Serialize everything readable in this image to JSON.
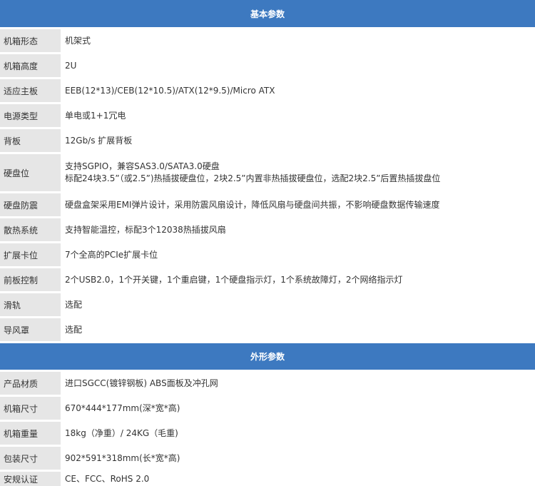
{
  "sections": [
    {
      "title": "基本参数",
      "rows": [
        {
          "label": "机箱形态",
          "lines": [
            "机架式"
          ]
        },
        {
          "label": "机箱高度",
          "lines": [
            "2U"
          ]
        },
        {
          "label": "适应主板",
          "lines": [
            "EEB(12*13)/CEB(12*10.5)/ATX(12*9.5)/Micro ATX"
          ]
        },
        {
          "label": "电源类型",
          "lines": [
            "单电或1+1冗电"
          ]
        },
        {
          "label": "背板",
          "lines": [
            "12Gb/s 扩展背板"
          ]
        },
        {
          "label": "硬盘位",
          "lines": [
            "支持SGPIO，兼容SAS3.0/SATA3.0硬盘",
            "标配24块3.5”（或2.5”)热插拔硬盘位，2块2.5”内置非热插拔硬盘位，选配2块2.5”后置热插拔盘位"
          ]
        },
        {
          "label": "硬盘防震",
          "lines": [
            "硬盘盒架采用EMI弹片设计，采用防震风扇设计，降低风扇与硬盘间共振，不影响硬盘数据传输速度"
          ]
        },
        {
          "label": "散热系统",
          "lines": [
            "支持智能温控，标配3个12038热插拔风扇"
          ]
        },
        {
          "label": "扩展卡位",
          "lines": [
            "7个全高的PCIe扩展卡位"
          ]
        },
        {
          "label": "前板控制",
          "lines": [
            "2个USB2.0，1个开关键，1个重启键，1个硬盘指示灯，1个系统故障灯，2个网络指示灯"
          ]
        },
        {
          "label": "滑轨",
          "lines": [
            "选配"
          ]
        },
        {
          "label": "导风罩",
          "lines": [
            "选配"
          ]
        }
      ]
    },
    {
      "title": "外形参数",
      "rows": [
        {
          "label": "产品材质",
          "lines": [
            "进口SGCC(镀锌钢板) ABS面板及冲孔网"
          ]
        },
        {
          "label": "机箱尺寸",
          "lines": [
            "670*444*177mm(深*宽*高)"
          ]
        },
        {
          "label": "机箱重量",
          "lines": [
            "18kg（净重）/ 24KG（毛重)"
          ]
        },
        {
          "label": "包装尺寸",
          "lines": [
            "902*591*318mm(长*宽*高)"
          ]
        },
        {
          "label": "安规认证",
          "lines": [
            "CE、FCC、RoHS 2.0"
          ]
        }
      ]
    }
  ]
}
